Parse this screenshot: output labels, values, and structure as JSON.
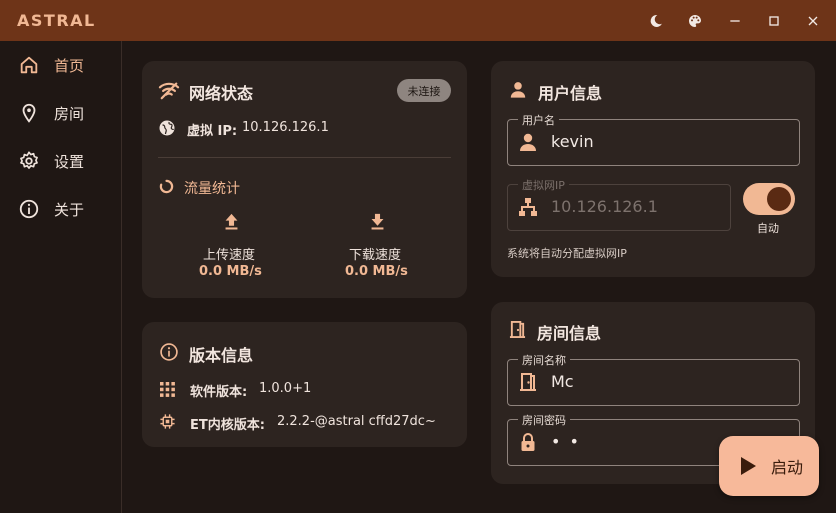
{
  "window": {
    "app_title": "ASTRAL",
    "controls": [
      "theme-toggle",
      "palette",
      "minimize",
      "maximize",
      "close"
    ]
  },
  "sidebar": {
    "items": [
      {
        "label": "首页",
        "icon": "home-icon",
        "active": true
      },
      {
        "label": "房间",
        "icon": "location-pin-icon",
        "active": false
      },
      {
        "label": "设置",
        "icon": "gear-icon",
        "active": false
      },
      {
        "label": "关于",
        "icon": "info-icon",
        "active": false
      }
    ]
  },
  "network": {
    "title": "网络状态",
    "status_badge": "未连接",
    "ip_label": "虚拟 IP:",
    "ip_value": "10.126.126.1",
    "traffic_title": "流量统计",
    "upload_label": "上传速度",
    "upload_value": "0.0 MB/s",
    "download_label": "下载速度",
    "download_value": "0.0 MB/s"
  },
  "version": {
    "title": "版本信息",
    "software_label": "软件版本:",
    "software_value": "1.0.0+1",
    "core_label": "ET内核版本:",
    "core_value": "2.2.2-@astral cffd27dc~"
  },
  "user": {
    "title": "用户信息",
    "username_label": "用户名",
    "username_value": "kevin",
    "vip_label": "虚拟网IP",
    "vip_value": "10.126.126.1",
    "auto_label": "自动",
    "auto_enabled": true,
    "hint": "系统将自动分配虚拟网IP"
  },
  "room": {
    "title": "房间信息",
    "name_label": "房间名称",
    "name_value": "Mc",
    "password_label": "房间密码",
    "password_value": "• •"
  },
  "start_button": {
    "label": "启动"
  },
  "colors": {
    "accent": "#f1b894",
    "titlebar": "#6e3418",
    "card": "#2d2420",
    "background": "#1f1714"
  }
}
